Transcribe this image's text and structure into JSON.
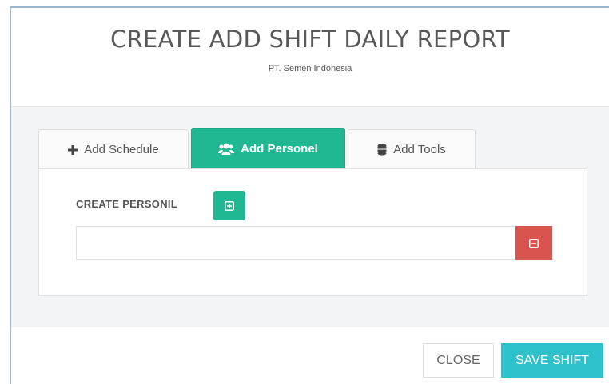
{
  "header": {
    "title": "CREATE ADD SHIFT DAILY REPORT",
    "subtitle": "PT. Semen Indonesia"
  },
  "tabs": [
    {
      "label": "Add Schedule",
      "icon": "plus-icon",
      "active": false
    },
    {
      "label": "Add Personel",
      "icon": "users-icon",
      "active": true
    },
    {
      "label": "Add Tools",
      "icon": "database-icon",
      "active": false
    }
  ],
  "personnel_panel": {
    "label": "CREATE PERSONIL",
    "add_icon": "plus-square-icon",
    "input_value": "",
    "remove_icon": "minus-square-icon"
  },
  "footer": {
    "close_label": "CLOSE",
    "save_label": "SAVE SHIFT"
  },
  "colors": {
    "accent_green": "#1fb893",
    "save_cyan": "#2ec1cc",
    "danger_red": "#d9534f",
    "title_gray": "#585858"
  }
}
